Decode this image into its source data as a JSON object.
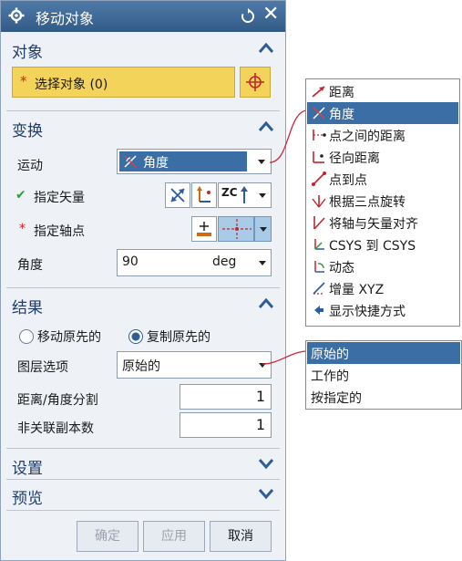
{
  "dialog": {
    "title": "移动对象",
    "close_glyph": "✕"
  },
  "sections": {
    "object": {
      "title": "对象",
      "select_required": "*",
      "select_label": "选择对象 (0)"
    },
    "transform": {
      "title": "变换",
      "motion_label": "运动",
      "motion_value": "角度",
      "vector_label": "指定矢量",
      "vector_check": "✔",
      "vector_axis_text": "ZC",
      "pivot_required": "*",
      "pivot_label": "指定轴点",
      "angle_label": "角度",
      "angle_value": "90",
      "angle_unit": "deg"
    },
    "result": {
      "title": "结果",
      "radio_move": "移动原先的",
      "radio_copy": "复制原先的",
      "radio_selected": "copy",
      "layer_label": "图层选项",
      "layer_value": "原始的",
      "split_label": "距离/角度分割",
      "split_value": "1",
      "copies_label": "非关联副本数",
      "copies_value": "1"
    },
    "settings": {
      "title": "设置"
    },
    "preview": {
      "title": "预览"
    }
  },
  "buttons": {
    "ok": "确定",
    "apply": "应用",
    "cancel": "取消"
  },
  "motion_menu": {
    "items": [
      {
        "label": "距离",
        "icon": "distance-icon"
      },
      {
        "label": "角度",
        "icon": "angle-icon",
        "selected": true
      },
      {
        "label": "点之间的距离",
        "icon": "distance-between-points-icon"
      },
      {
        "label": "径向距离",
        "icon": "radial-distance-icon"
      },
      {
        "label": "点到点",
        "icon": "point-to-point-icon"
      },
      {
        "label": "根据三点旋转",
        "icon": "rotate-by-three-points-icon"
      },
      {
        "label": "将轴与矢量对齐",
        "icon": "align-axis-to-vector-icon"
      },
      {
        "label": "CSYS 到 CSYS",
        "icon": "csys-to-csys-icon"
      },
      {
        "label": "动态",
        "icon": "dynamic-icon"
      },
      {
        "label": "增量 XYZ",
        "icon": "delta-xyz-icon"
      },
      {
        "label": "显示快捷方式",
        "icon": "show-shortcuts-icon"
      }
    ]
  },
  "layer_menu": {
    "items": [
      {
        "label": "原始的",
        "selected": true
      },
      {
        "label": "工作的"
      },
      {
        "label": "按指定的"
      }
    ]
  },
  "colors": {
    "title_bar": "#3d6896",
    "selection_yellow": "#f4d35b",
    "highlight_blue": "#3a6ea5",
    "connector_red": "#d0283a"
  }
}
